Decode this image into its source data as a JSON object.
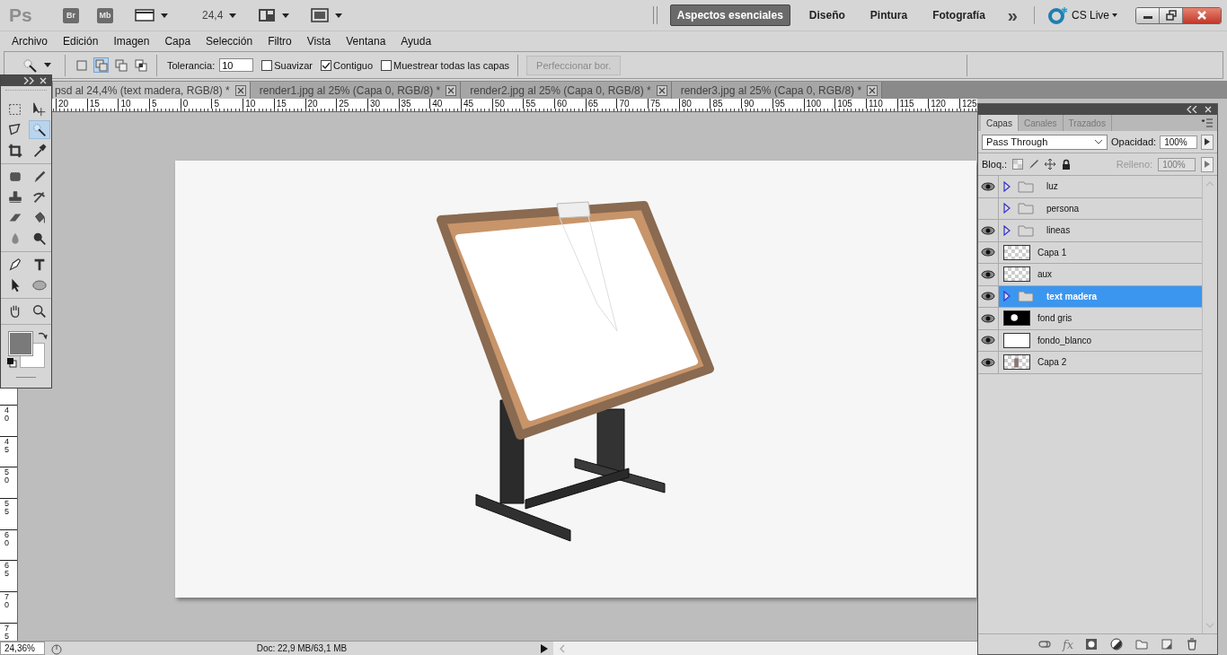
{
  "app": {
    "logo": "Ps",
    "launchers": [
      "Br",
      "Mb"
    ],
    "zoom": "24,4"
  },
  "workspaces": [
    {
      "label": "Aspectos esenciales",
      "selected": true
    },
    {
      "label": "Diseño",
      "selected": false
    },
    {
      "label": "Pintura",
      "selected": false
    },
    {
      "label": "Fotografía",
      "selected": false
    }
  ],
  "more": "»",
  "cs_live": "CS Live",
  "menu": [
    "Archivo",
    "Edición",
    "Imagen",
    "Capa",
    "Selección",
    "Filtro",
    "Vista",
    "Ventana",
    "Ayuda"
  ],
  "options": {
    "modes": [
      {
        "kind": "new",
        "selected": false
      },
      {
        "kind": "add",
        "selected": true
      },
      {
        "kind": "subtract",
        "selected": false
      },
      {
        "kind": "intersect",
        "selected": false
      }
    ],
    "tolerance_label": "Tolerancia:",
    "tolerance": "10",
    "checks": [
      {
        "label": "Suavizar",
        "checked": false
      },
      {
        "label": "Contiguo",
        "checked": true
      },
      {
        "label": "Muestrear todas las capas",
        "checked": false
      }
    ],
    "refine": {
      "label": "Perfeccionar bor.",
      "disabled": true
    }
  },
  "tabs": [
    {
      "label": "psd al 24,4% (text madera, RGB/8) *",
      "selected": true
    },
    {
      "label": "render1.jpg al 25% (Capa 0, RGB/8) *",
      "selected": false
    },
    {
      "label": "render2.jpg al 25% (Capa 0, RGB/8) *",
      "selected": false
    },
    {
      "label": "render3.jpg al 25% (Capa 0, RGB/8) *",
      "selected": false
    }
  ],
  "ruler": {
    "h": [
      "20",
      "15",
      "10",
      "5",
      "0",
      "5",
      "10",
      "15",
      "20",
      "25",
      "30",
      "35",
      "40",
      "45",
      "50",
      "55",
      "60",
      "65",
      "70",
      "75",
      "80",
      "85",
      "90",
      "95",
      "100",
      "105",
      "110",
      "115",
      "120",
      "125"
    ],
    "v": [
      "40",
      "45",
      "50",
      "55",
      "60",
      "65",
      "70",
      "75"
    ]
  },
  "toolbox": {
    "tools": [
      {
        "kind": "marquee",
        "selected": false
      },
      {
        "kind": "move",
        "selected": false
      },
      {
        "kind": "lasso",
        "selected": false
      },
      {
        "kind": "wand",
        "selected": true
      },
      {
        "kind": "crop",
        "selected": false
      },
      {
        "kind": "eyedropper",
        "selected": false
      },
      {
        "kind": "patch",
        "selected": false
      },
      {
        "kind": "brush",
        "selected": false
      },
      {
        "kind": "stamp",
        "selected": false
      },
      {
        "kind": "history",
        "selected": false
      },
      {
        "kind": "eraser",
        "selected": false
      },
      {
        "kind": "bucket",
        "selected": false
      },
      {
        "kind": "drop",
        "selected": false
      },
      {
        "kind": "dodge",
        "selected": false
      },
      {
        "kind": "pen",
        "selected": false
      },
      {
        "kind": "type",
        "selected": false
      },
      {
        "kind": "arrow",
        "selected": false
      },
      {
        "kind": "ellipse",
        "selected": false
      },
      {
        "kind": "hand",
        "selected": false
      },
      {
        "kind": "zoom",
        "selected": false
      }
    ],
    "foreground_shown": true
  },
  "layers_panel": {
    "tabs": [
      {
        "label": "Capas",
        "selected": true
      },
      {
        "label": "Canales",
        "selected": false
      },
      {
        "label": "Trazados",
        "selected": false
      }
    ],
    "blend_mode": "Pass Through",
    "opacity_label": "Opacidad:",
    "opacity": "100%",
    "lock_label": "Bloq.:",
    "fill_label": "Relleno:",
    "fill": "100%",
    "fill_disabled": true,
    "layers": [
      {
        "name": "luz",
        "kind": "group",
        "visible": true,
        "expanded": false,
        "selected": false
      },
      {
        "name": "persona",
        "kind": "group",
        "visible": false,
        "expanded": false,
        "selected": false
      },
      {
        "name": "lineas",
        "kind": "group",
        "visible": true,
        "expanded": false,
        "selected": false
      },
      {
        "name": "Capa 1",
        "kind": "checker",
        "visible": true,
        "selected": false
      },
      {
        "name": "aux",
        "kind": "checker",
        "visible": true,
        "selected": false
      },
      {
        "name": "text madera",
        "kind": "group",
        "visible": true,
        "expanded": false,
        "selected": true
      },
      {
        "name": "fond gris",
        "kind": "black",
        "visible": true,
        "selected": false
      },
      {
        "name": "fondo_blanco",
        "kind": "white",
        "visible": true,
        "selected": false
      },
      {
        "name": "Capa 2",
        "kind": "figure",
        "visible": true,
        "selected": false
      }
    ],
    "footer": [
      {
        "kind": "link"
      },
      {
        "kind": "fx",
        "label": "fx"
      },
      {
        "kind": "mask"
      },
      {
        "kind": "adjust"
      },
      {
        "kind": "folder"
      },
      {
        "kind": "new"
      },
      {
        "kind": "trash"
      }
    ]
  },
  "status": {
    "zoom": "24,36%",
    "doc": "Doc: 22,9 MB/63,1 MB"
  }
}
